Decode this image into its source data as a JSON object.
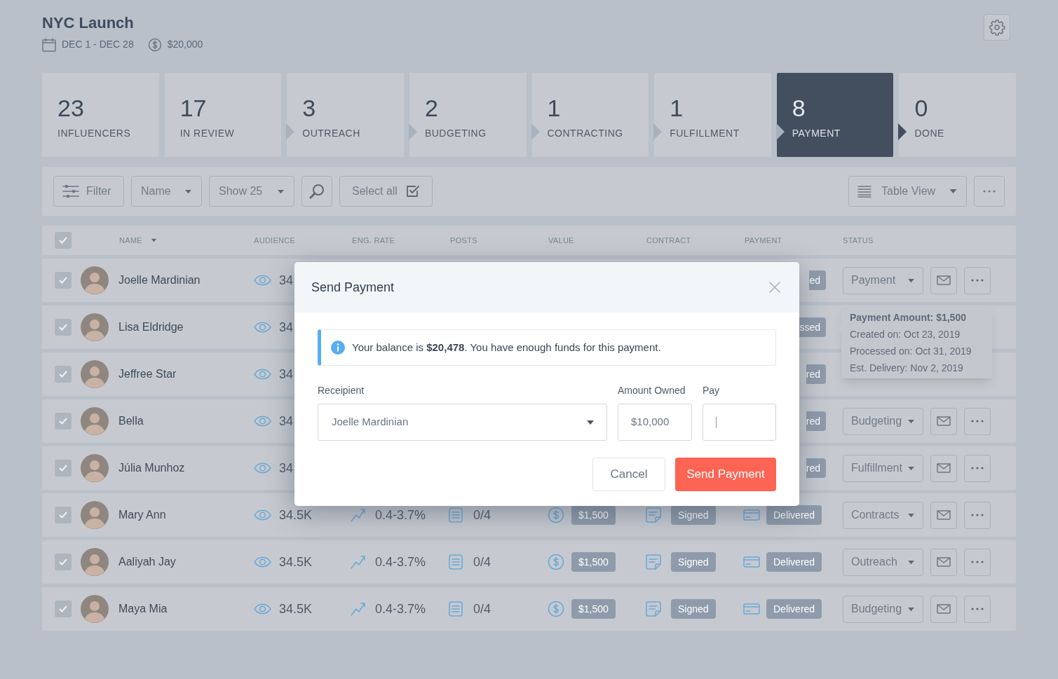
{
  "campaign": {
    "title": "NYC Launch",
    "dates": "DEC 1 - DEC 28",
    "budget": "$20,000"
  },
  "stages": [
    {
      "count": "23",
      "label": "INFLUENCERS",
      "selected": false
    },
    {
      "count": "17",
      "label": "IN REVIEW",
      "selected": false
    },
    {
      "count": "3",
      "label": "OUTREACH",
      "selected": false
    },
    {
      "count": "2",
      "label": "BUDGETING",
      "selected": false
    },
    {
      "count": "1",
      "label": "CONTRACTING",
      "selected": false
    },
    {
      "count": "1",
      "label": "FULFILLMENT",
      "selected": false
    },
    {
      "count": "8",
      "label": "PAYMENT",
      "selected": true
    },
    {
      "count": "0",
      "label": "DONE",
      "selected": false
    }
  ],
  "toolbar": {
    "filter": "Filter",
    "sort": "Name",
    "page_size": "Show 25",
    "select_all": "Select all",
    "view": "Table View"
  },
  "table": {
    "select_all_checked": true,
    "columns": [
      "NAME",
      "AUDIENCE",
      "ENG. RATE",
      "POSTS",
      "VALUE",
      "CONTRACT",
      "PAYMENT",
      "STATUS"
    ],
    "rows": [
      {
        "kind": "partial",
        "checked": true,
        "name": "Joelle Mardinian",
        "audience": "34",
        "payment": "ed",
        "status": "Payment"
      },
      {
        "kind": "partial",
        "checked": true,
        "name": "Lisa Eldridge",
        "audience": "34",
        "payment": "ssed"
      },
      {
        "kind": "partial",
        "checked": true,
        "name": "Jeffree Star",
        "audience": "34",
        "payment": "red"
      },
      {
        "kind": "partial",
        "checked": true,
        "name": "Bella",
        "audience": "34",
        "payment": "red",
        "status": "Budgeting"
      },
      {
        "kind": "partial",
        "checked": true,
        "name": "Júlia Munhoz",
        "audience": "34",
        "payment": "red",
        "status": "Fulfillment"
      },
      {
        "kind": "full",
        "checked": true,
        "name": "Mary Ann",
        "audience": "34.5K",
        "eng_rate": "0.4-3.7%",
        "posts": "0/4",
        "value": "$1,500",
        "contract": "Signed",
        "payment": "Delivered",
        "status": "Contracts"
      },
      {
        "kind": "full",
        "checked": true,
        "name": "Aaliyah Jay",
        "audience": "34.5K",
        "eng_rate": "0.4-3.7%",
        "posts": "0/4",
        "value": "$1,500",
        "contract": "Signed",
        "payment": "Delivered",
        "status": "Outreach"
      },
      {
        "kind": "full",
        "checked": true,
        "name": "Maya Mia",
        "audience": "34.5K",
        "eng_rate": "0.4-3.7%",
        "posts": "0/4",
        "value": "$1,500",
        "contract": "Signed",
        "payment": "Delivered",
        "status": "Budgeting"
      }
    ]
  },
  "tooltip": [
    "**Payment Amount: $1,500**",
    "Created on: Oct 23, 2019",
    "Processed on: Oct 31, 2019",
    "Est. Delivery: Nov 2, 2019"
  ],
  "modal": {
    "title": "Send Payment",
    "info": "Your balance is **$20,478**. You have enough funds for this payment.",
    "recipient": {
      "label": "Receipient",
      "value": "Joelle Mardinian"
    },
    "amount": {
      "label": "Amount Owned",
      "value": "$10,000"
    },
    "pay": {
      "label": "Pay",
      "focused": true
    },
    "buttons": [
      "Cancel",
      "Send Payment"
    ]
  }
}
